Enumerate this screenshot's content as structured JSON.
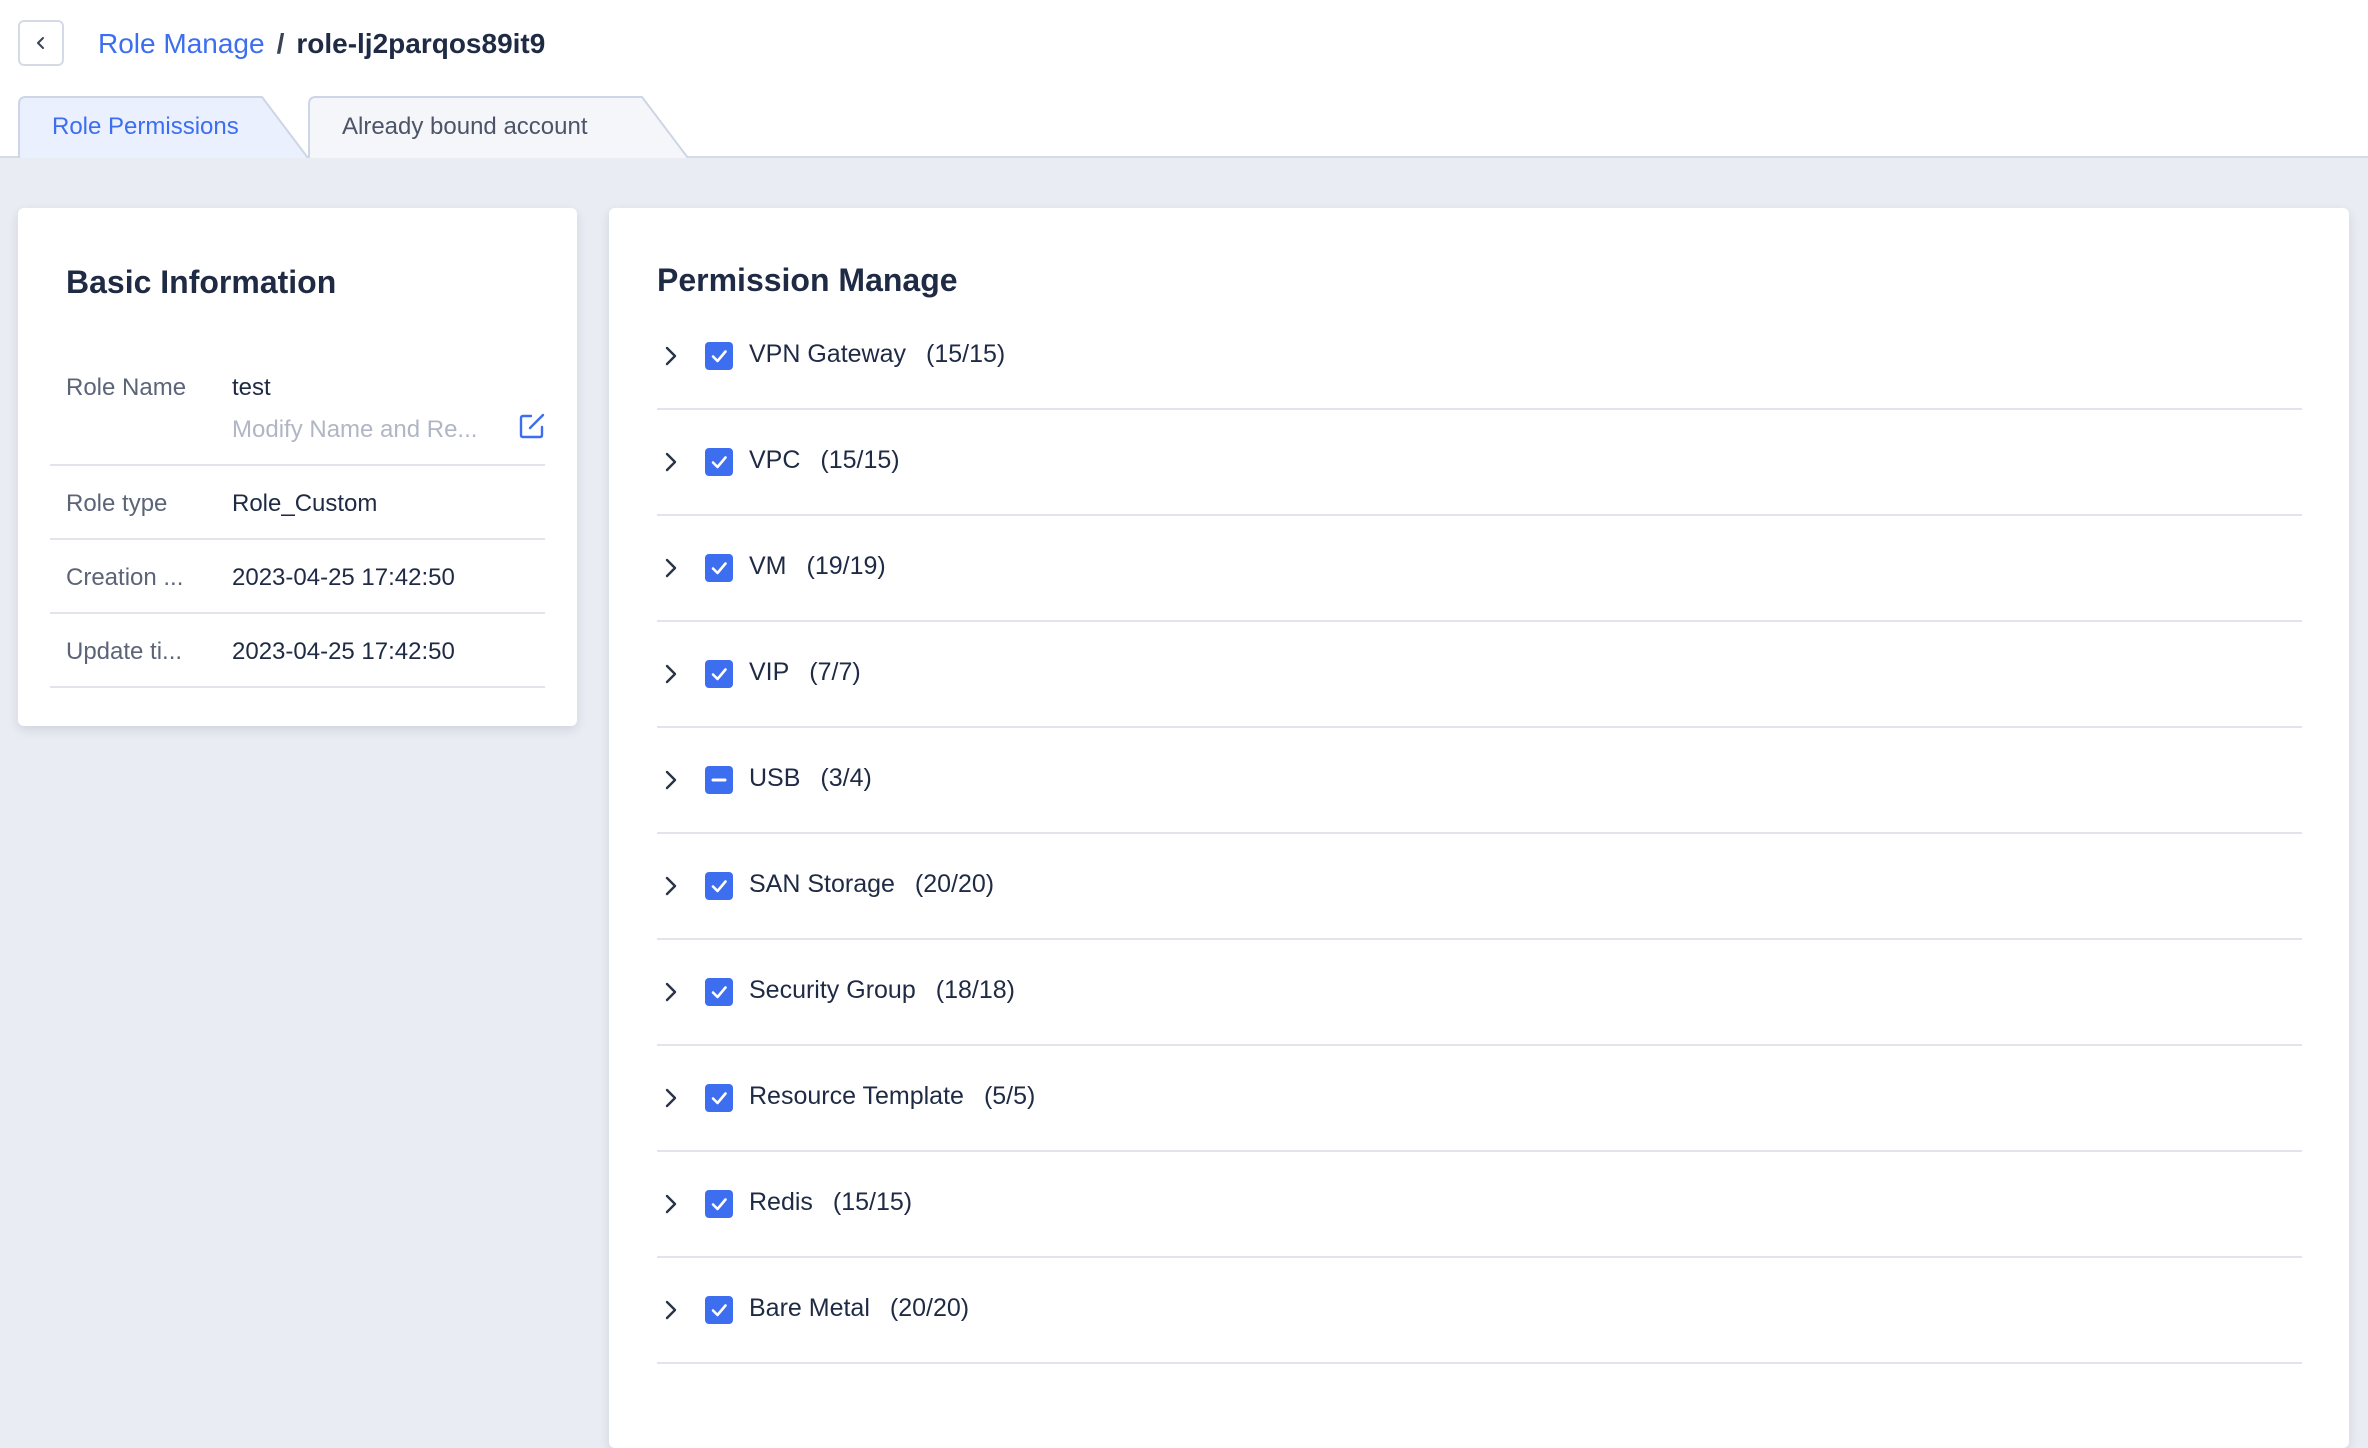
{
  "breadcrumb": {
    "parent": "Role Manage",
    "separator": "/",
    "current": "role-lj2parqos89it9"
  },
  "tabs": [
    {
      "label": "Role Permissions",
      "active": true
    },
    {
      "label": "Already bound account",
      "active": false
    }
  ],
  "basic_info": {
    "title": "Basic Information",
    "rows": [
      {
        "label": "Role Name",
        "value": "test",
        "hint": "Modify Name and Re..."
      },
      {
        "label": "Role type",
        "value": "Role_Custom"
      },
      {
        "label": "Creation ...",
        "value": "2023-04-25 17:42:50"
      },
      {
        "label": "Update ti...",
        "value": "2023-04-25 17:42:50"
      }
    ]
  },
  "permissions": {
    "title": "Permission Manage",
    "items": [
      {
        "name": "VPN Gateway",
        "count": "(15/15)",
        "state": "checked"
      },
      {
        "name": "VPC",
        "count": "(15/15)",
        "state": "checked"
      },
      {
        "name": "VM",
        "count": "(19/19)",
        "state": "checked"
      },
      {
        "name": "VIP",
        "count": "(7/7)",
        "state": "checked"
      },
      {
        "name": "USB",
        "count": "(3/4)",
        "state": "indeterminate"
      },
      {
        "name": "SAN Storage",
        "count": "(20/20)",
        "state": "checked"
      },
      {
        "name": "Security Group",
        "count": "(18/18)",
        "state": "checked"
      },
      {
        "name": "Resource Template",
        "count": "(5/5)",
        "state": "checked"
      },
      {
        "name": "Redis",
        "count": "(15/15)",
        "state": "checked"
      },
      {
        "name": "Bare Metal",
        "count": "(20/20)",
        "state": "checked"
      }
    ]
  },
  "colors": {
    "accent": "#3d6ef0",
    "page_bg": "#e9ecf3",
    "text": "#1f2a44",
    "muted": "#5c6478"
  },
  "icons": {
    "back": "chevron-left-icon",
    "edit": "edit-icon",
    "expand": "chevron-right-icon",
    "check": "checkbox-icon"
  }
}
